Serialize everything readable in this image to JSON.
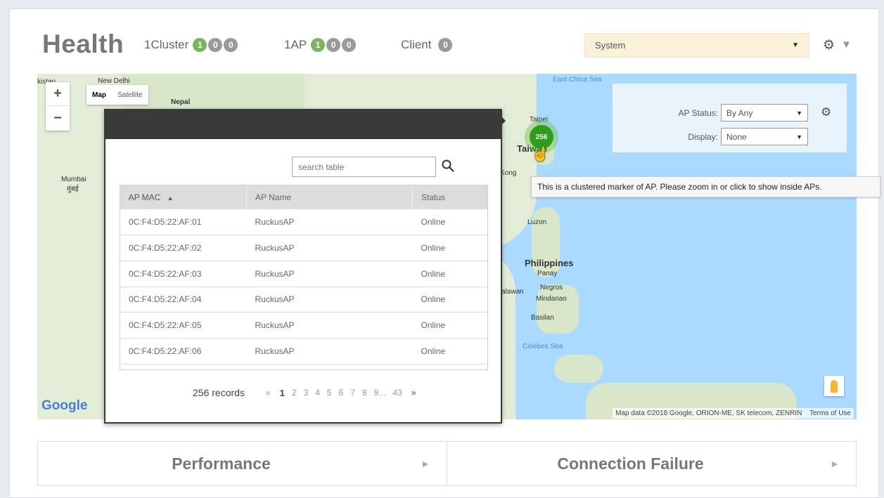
{
  "header": {
    "title": "Health",
    "cluster": {
      "label": "1Cluster",
      "pills": [
        "1",
        "0",
        "0"
      ]
    },
    "ap": {
      "label": "1AP",
      "pills": [
        "1",
        "0",
        "0"
      ]
    },
    "client": {
      "label": "Client",
      "pills": [
        "0"
      ]
    },
    "system_select": "System",
    "gear_icon": "gear-icon",
    "caret_icon": "caret-down-icon"
  },
  "map": {
    "type_buttons": {
      "map": "Map",
      "satellite": "Satellite"
    },
    "zoom_in": "+",
    "zoom_out": "−",
    "labels": {
      "pakistan": "kistan",
      "new_delhi": "New Delhi",
      "nepal": "Nepal",
      "mumbai": "Mumbai",
      "mumbai_local": "मुंबई",
      "east_china_sea": "East China Sea",
      "taipei": "Taipei",
      "taiwan": "Taiwan",
      "hong_kong": "Kong",
      "luzon": "Luzon",
      "philippines": "Philippines",
      "panay": "Panay",
      "palawan": "alawan",
      "negros": "Negros",
      "mindanao": "Mindanao",
      "basilan": "Basilan",
      "celebes_sea": "Celebes Sea"
    },
    "google_logo": "Google",
    "map_data": "Map data ©2018 Google, ORION-ME, SK telecom, ZENRIN",
    "terms": "Terms of Use",
    "cluster_count": "256",
    "tooltip": "This is a clustered marker of AP. Please zoom in or click to show inside APs."
  },
  "filter": {
    "ap_status_label": "AP Status:",
    "ap_status_value": "By Any",
    "display_label": "Display:",
    "display_value": "None"
  },
  "popup": {
    "search_placeholder": "search table",
    "columns": [
      "AP MAC",
      "AP Name",
      "Status"
    ],
    "sort_indicator": "▲",
    "rows": [
      [
        "0C:F4:D5:22:AF:01",
        "RuckusAP",
        "Online"
      ],
      [
        "0C:F4:D5:22:AF:02",
        "RuckusAP",
        "Online"
      ],
      [
        "0C:F4:D5:22:AF:03",
        "RuckusAP",
        "Online"
      ],
      [
        "0C:F4:D5:22:AF:04",
        "RuckusAP",
        "Online"
      ],
      [
        "0C:F4:D5:22:AF:05",
        "RuckusAP",
        "Online"
      ],
      [
        "0C:F4:D5:22:AF:06",
        "RuckusAP",
        "Online"
      ]
    ],
    "records": "256 records",
    "prev": "«",
    "pages": [
      "1",
      "2",
      "3",
      "4",
      "5",
      "6",
      "7",
      "8",
      "9...",
      "43"
    ],
    "next": "»"
  },
  "bottom_tabs": {
    "performance": "Performance",
    "connection_failure": "Connection Failure",
    "arrow": "►"
  }
}
